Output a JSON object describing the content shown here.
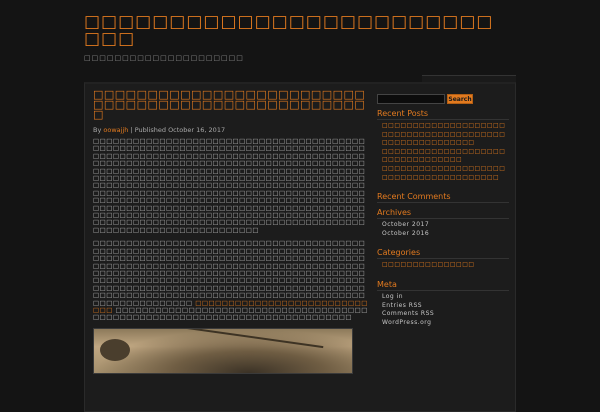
{
  "site": {
    "title": "□□□□□□□□□□□□□□□□□□□□□□□□□□□",
    "description": "□□□□□□□□□□□□□□□□□□□□□"
  },
  "post": {
    "title": "□□□□□□□□□□□□□□□□□□□□□□□□□□□□□□□□□□□□□□□□□□□□□□□□□□□",
    "meta_prefix": "By",
    "author": "oowajjh",
    "meta_suffix": "| Published October 16, 2017",
    "paragraphs": [
      "□□□□□□□□□□□□□□□□□□□□□□□□□□□□□□□□□□□□□□□□□□□□□□□□□□□□□□□□□□□□□□□□□□□□□□□□□□□□□□□□□□□□□□□□□□□□□□□□□□□□□□□□□□□□□□□□□□□□□□□□□□□□□□□□□□□□□□□□□□□□□□□□□□□□□□□□□□□□□□□□□□□□□□□□□□□□□□□□□□□□□□□□□□□□□□□□□□□□□□□□□□□□□□□□□□□□□□□□□□□□□□□□□□□□□□□□□□□□□□□□□□□□□□□□□□□□□□□□□□□□□□□□□□□□□□□□□□□□□□□□□□□□□□□□□□□□□□□□□□□□□□□□□□□□□□□□□□□□□□□□□□□□□□□□□□□□□□□□□□□□□□□□□□□□□□□□□□□□□□□□□□□□□□□□□□□□□□□□□□□□□□□□□□□□□□□□□□□□□□□□□□□□□□□□□□□□□□□□□□□□□□□□□□□□□□□□□□□□□□□□□□□□□□□□□□□□□□□□□□□□□□□□□□□□□□□□□□□□□□□□□□□□□□□□□□□□□□□□□□□□□□□□□□□□□□□□□□□□□",
      "□□□□□□□□□□□□□□□□□□□□□□□□□□□□□□□□□□□□□□□□□□□□□□□□□□□□□□□□□□□□□□□□□□□□□□□□□□□□□□□□□□□□□□□□□□□□□□□□□□□□□□□□□□□□□□□□□□□□□□□□□□□□□□□□□□□□□□□□□□□□□□□□□□□□□□□□□□□□□□□□□□□□□□□□□□□□□□□□□□□□□□□□□□□□□□□□□□□□□□□□□□□□□□□□□□□□□□□□□□□□□□□□□□□□□□□□□□□□□□□□□□□□□□□□□□□□□□□□□□□□□□□□□□□□□□□□□□□□□□□□□□□□□□□□□□□□□□□□□□□□□□□□□□□□□□□□□□□□□□□□□□□□□□□□□□□□□□□□□□□□□□□"
    ],
    "link_text": "□□□□□□□□□□□□□□□□□□□□□□□□□□□□□",
    "tail_text": "□□□□□□□□□□□□□□□□□□□□□□□□□□□□□□□□□□□□□□□□□□□□□□□□□□□□□□□□□□□□□□□□□□□□□□□□□□□□□"
  },
  "search": {
    "button_label": "Search"
  },
  "sidebar": {
    "recent_posts": {
      "title": "Recent Posts",
      "items": [
        "□□□□□□□□□□□□□□□□□□□□",
        "□□□□□□□□□□□□□□□□□□□□",
        "□□□□□□□□□□□□□□□",
        "□□□□□□□□□□□□□□□□□□□□",
        "□□□□□□□□□□□□□",
        "□□□□□□□□□□□□□□□□□□□□",
        "□□□□□□□□□□□□□□□□□□□"
      ]
    },
    "recent_comments": {
      "title": "Recent Comments"
    },
    "archives": {
      "title": "Archives",
      "items": [
        "October 2017",
        "October 2016"
      ]
    },
    "categories": {
      "title": "Categories",
      "items": [
        "□□□□□□□□□□□□□□□"
      ]
    },
    "meta": {
      "title": "Meta",
      "items": [
        "Log in",
        "Entries RSS",
        "Comments RSS",
        "WordPress.org"
      ]
    }
  }
}
